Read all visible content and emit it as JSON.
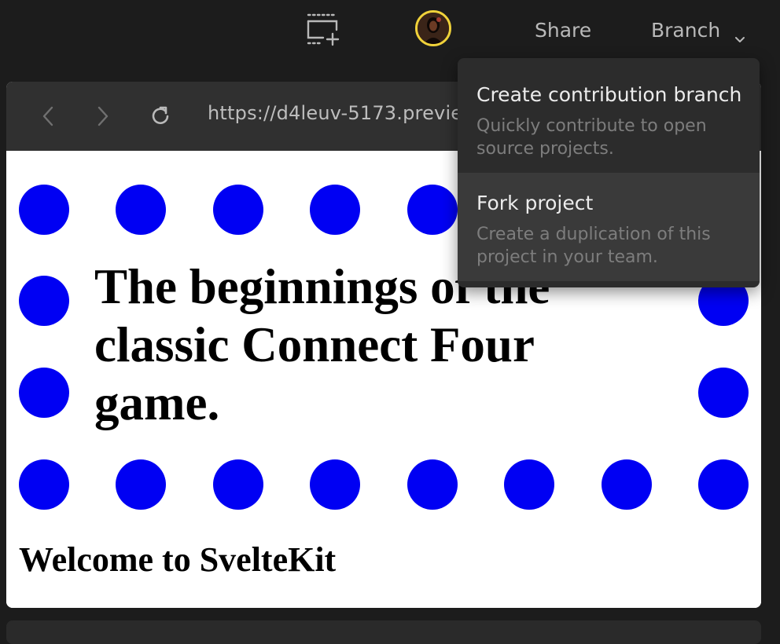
{
  "topbar": {
    "share_label": "Share",
    "branch_label": "Branch"
  },
  "browser": {
    "url": "https://d4leuv-5173.previe"
  },
  "page": {
    "headline": "The beginnings of the classic Connect Four game.",
    "subheading": "Welcome to SvelteKit",
    "dot_color": "#0000f3"
  },
  "branch_menu": {
    "items": [
      {
        "title": "Create contribution branch",
        "description": "Quickly contribute to open source projects."
      },
      {
        "title": "Fork project",
        "description": "Create a duplication of this project in your team."
      }
    ]
  },
  "colors": {
    "background": "#1c1c1c",
    "avatar_ring": "#f0d23a",
    "menu_bg": "#2c2c2c",
    "menu_hover": "#3a3a3a"
  }
}
